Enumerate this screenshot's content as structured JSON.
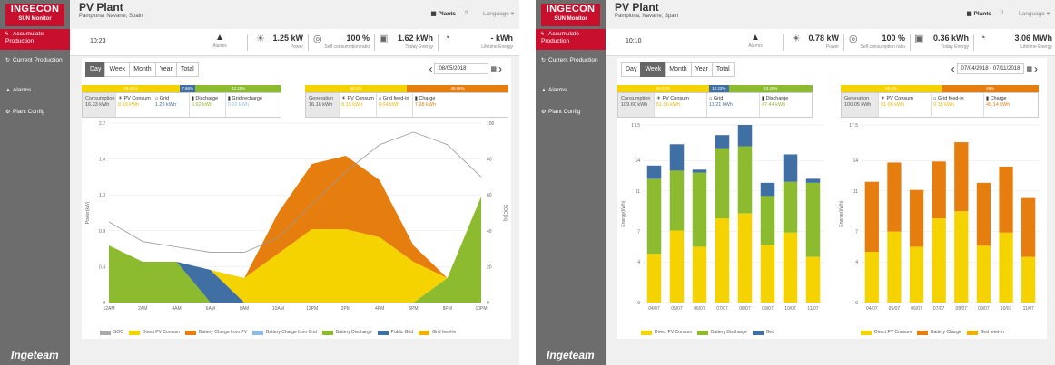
{
  "app": {
    "logo": "INGECON",
    "logo_sub": "SUN Monitor",
    "footer": "Ingeteam"
  },
  "nav": [
    {
      "label": "Accumulate Production",
      "icon": "bolt-icon",
      "active": true
    },
    {
      "label": "Current Production",
      "icon": "refresh-icon"
    },
    {
      "label": "Alarms",
      "icon": "bell-icon"
    },
    {
      "label": "Plant Config",
      "icon": "gear-icon"
    }
  ],
  "plant": {
    "title": "PV Plant",
    "location": "Pamplona, Navarre, Spain"
  },
  "header": {
    "plants": "Plants",
    "language": "Language"
  },
  "screen1": {
    "time": "10:23",
    "alarms": "Alarms",
    "power": "1.25 kW",
    "power_lbl": "Power",
    "ratio": "100 %",
    "ratio_lbl": "Self consumption ratio",
    "today": "1.62 kWh",
    "today_lbl": "Today Energy",
    "lifetime": "- kWh",
    "lifetime_lbl": "Lifetime Energy",
    "tabs": [
      "Day",
      "Week",
      "Month",
      "Year",
      "Total"
    ],
    "active_tab": 0,
    "date": "08/05/2018",
    "cons_bar": [
      "49.03%",
      "7.66%",
      "42.20%"
    ],
    "gen_bar": [
      "60.2%",
      "49.56%"
    ],
    "consumption": {
      "label": "Consumption",
      "value": "16.33 kWh",
      "items": [
        [
          "PV Consum",
          "8.19 kWh"
        ],
        [
          "Grid",
          "1.25 kWh"
        ],
        [
          "Discharge",
          "6.92 kWh"
        ],
        [
          "Grid recharge",
          "0.02 kWh"
        ]
      ]
    },
    "generation": {
      "label": "Generation",
      "value": "16.16 kWh",
      "items": [
        [
          "PV Consum",
          "8.15 kWh"
        ],
        [
          "Grid feed-in",
          "0.04 kWh"
        ],
        [
          "Charge",
          "7.98 kWh"
        ]
      ]
    },
    "y_label": "Power(kW)",
    "y2_label": "SOC(%)",
    "y_ticks": [
      "0",
      "0.4",
      "0.9",
      "1.3",
      "1.8",
      "2.2"
    ],
    "y2_ticks": [
      "0",
      "20",
      "40",
      "60",
      "80",
      "100"
    ],
    "x_ticks": [
      "12AM",
      "2AM",
      "4AM",
      "6AM",
      "8AM",
      "10AM",
      "12PM",
      "2PM",
      "4PM",
      "6PM",
      "8PM",
      "10PM"
    ],
    "legend": [
      "SOC",
      "Direct PV Consum",
      "Battery Charge from PV",
      "Battery Charge from Grid",
      "Battery Discharge",
      "Public Grid",
      "Grid feed-in"
    ]
  },
  "screen2": {
    "time": "10:10",
    "alarms": "Alarms",
    "power": "0.78 kW",
    "power_lbl": "Power",
    "ratio": "100 %",
    "ratio_lbl": "Self consumption ratio",
    "today": "0.36 kWh",
    "today_lbl": "Today Energy",
    "lifetime": "3.06 MWh",
    "lifetime_lbl": "Lifetime Energy",
    "tabs": [
      "Day",
      "Week",
      "Month",
      "Year",
      "Total"
    ],
    "active_tab": 1,
    "date": "07/04/2018 - 07/11/2018",
    "cons_bar": [
      "46.61%",
      "10.22%",
      "43.20%"
    ],
    "gen_bar": [
      "50.9%",
      "49%"
    ],
    "consumption": {
      "label": "Consumption",
      "value": "109.60 kWh",
      "items": [
        [
          "PV Consum",
          "51.06 kWh"
        ],
        [
          "Grid",
          "11.21 kWh"
        ],
        [
          "Discharge",
          "47.44 kWh"
        ]
      ]
    },
    "generation": {
      "label": "Generation",
      "value": "100.05 kWh",
      "items": [
        [
          "PV Consum",
          "51.06 kWh"
        ],
        [
          "Grid feed-in",
          "0.15 kWh"
        ],
        [
          "Charge",
          "49.14 kWh"
        ]
      ]
    },
    "y_label": "Energy(kWh)",
    "y_ticks": [
      "0",
      "4",
      "7",
      "11",
      "14",
      "17.5"
    ],
    "y_ticks_gen": [
      "0",
      "4",
      "7",
      "11",
      "14",
      "17.5"
    ],
    "legend1": [
      "Direct PV Consum",
      "Battery Discharge",
      "Grid"
    ],
    "legend2": [
      "Direct PV Consum",
      "Battery Charge",
      "Grid feed-in"
    ]
  },
  "chart_data": [
    {
      "type": "area",
      "title": "",
      "xlabel": "",
      "ylabel": "Power(kW)",
      "ylim": [
        0,
        2.2
      ],
      "y2label": "SOC(%)",
      "y2lim": [
        0,
        100
      ],
      "x": [
        "12AM",
        "2AM",
        "4AM",
        "6AM",
        "8AM",
        "10AM",
        "12PM",
        "2PM",
        "4PM",
        "6PM",
        "8PM",
        "10PM"
      ],
      "series": [
        {
          "name": "Battery Discharge",
          "values": [
            0.7,
            0.5,
            0.5,
            0.0,
            0.0,
            0.0,
            0.0,
            0.0,
            0.0,
            0.0,
            0.3,
            1.3
          ]
        },
        {
          "name": "Public Grid",
          "values": [
            0,
            0,
            0,
            0.4,
            0,
            0,
            0,
            0,
            0,
            0,
            0,
            0
          ]
        },
        {
          "name": "Direct PV Consum",
          "values": [
            0,
            0,
            0,
            0,
            0.3,
            0.6,
            0.9,
            0.9,
            0.8,
            0.5,
            0,
            0
          ]
        },
        {
          "name": "Battery Charge from PV",
          "values": [
            0,
            0,
            0,
            0,
            0,
            0.5,
            0.8,
            0.9,
            0.7,
            0.2,
            0,
            0
          ]
        },
        {
          "name": "SOC",
          "values": [
            45,
            34,
            31,
            28,
            28,
            36,
            55,
            73,
            88,
            95,
            88,
            70
          ]
        }
      ]
    },
    {
      "type": "bar",
      "title": "",
      "ylabel": "Energy(kWh)",
      "ylim": [
        0,
        17.5
      ],
      "categories": [
        "04/07",
        "05/07",
        "06/07",
        "07/07",
        "08/07",
        "09/07",
        "10/07",
        "11/07"
      ],
      "series": [
        {
          "name": "Direct PV Consum",
          "values": [
            4.8,
            7.1,
            5.5,
            8.3,
            8.8,
            5.7,
            6.9,
            4.5
          ]
        },
        {
          "name": "Battery Discharge",
          "values": [
            7.4,
            5.9,
            7.3,
            6.9,
            6.6,
            4.8,
            5.0,
            7.3
          ]
        },
        {
          "name": "Grid",
          "values": [
            1.3,
            2.6,
            0.3,
            1.3,
            2.1,
            1.3,
            2.7,
            0.4
          ]
        }
      ]
    },
    {
      "type": "bar",
      "title": "",
      "ylabel": "Energy(kWh)",
      "ylim": [
        0,
        17.5
      ],
      "categories": [
        "04/07",
        "05/07",
        "06/07",
        "07/07",
        "08/07",
        "09/07",
        "10/07",
        "11/07"
      ],
      "series": [
        {
          "name": "Direct PV Consum",
          "values": [
            5.0,
            7.0,
            5.5,
            8.3,
            9.0,
            5.6,
            6.9,
            4.5
          ]
        },
        {
          "name": "Battery Charge",
          "values": [
            6.9,
            6.8,
            5.6,
            5.6,
            6.8,
            6.2,
            6.5,
            5.8
          ]
        },
        {
          "name": "Grid feed-in",
          "values": [
            0,
            0,
            0,
            0,
            0,
            0,
            0,
            0
          ]
        }
      ]
    }
  ],
  "colors": {
    "red": "#c8102e",
    "yellow": "#f5d300",
    "orange": "#e67e0f",
    "green": "#8dbb2f",
    "blue": "#3f6fa3",
    "lightblue": "#8fbce6",
    "gray": "#aaaaaa"
  }
}
